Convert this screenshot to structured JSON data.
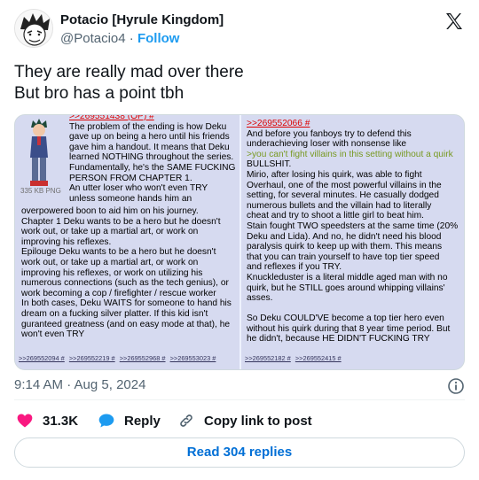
{
  "author": {
    "name": "Potacio [Hyrule Kingdom]",
    "handle": "@Potacio4",
    "dot": "·",
    "follow_label": "Follow"
  },
  "tweet": {
    "lines": [
      "They are really mad over there",
      "But bro has a point tbh"
    ]
  },
  "media": {
    "left_post": {
      "number": ">>269551438 (OP) #",
      "file_size": "335 KB PNG",
      "lines": [
        "The problem of the ending is how Deku",
        "gave up on being a hero until his friends",
        "gave him a handout. It means that Deku",
        "learned NOTHING throughout the series.",
        "Fundamentally, he's the SAME FUCKING",
        "PERSON FROM CHAPTER 1.",
        "An utter loser who won't even TRY",
        "unless someone hands him an",
        "overpowered boon to aid him on his journey.",
        "Chapter 1 Deku wants to be a hero but he doesn't",
        "work out, or take up a martial art, or work on",
        "improving his reflexes.",
        "Epilouge Deku wants to be a hero but he doesn't",
        "work out, or take up a martial art, or work on",
        "improving his reflexes, or work on utilizing his",
        "numerous connections (such as the tech genius), or",
        "work becoming a cop / firefighter / rescue worker",
        "In both cases, Deku WAITS for someone to hand his",
        "dream on a fucking silver platter. If this kid isn't",
        "guranteed greatness (and on easy mode at that), he",
        "won't even TRY"
      ],
      "backlinks": [
        ">>269552094 #",
        ">>269552219 #",
        ">>269552968 #",
        ">>269553023 #"
      ]
    },
    "right_post": {
      "number": ">>269552066 #",
      "lines": [
        "And before you fanboys try to defend this",
        "underachieving loser with nonsense like",
        ">you can't fight villains in this setting without a quirk",
        "BULLSHIT.",
        "Mirio, after losing his quirk, was able to fight",
        "Overhaul, one of the most powerful villains in the",
        "setting, for several minutes. He casually dodged",
        "numerous bullets and the villain had to literally",
        "cheat and try to shoot a little girl to beat him.",
        "Stain fought TWO speedsters at the same time (20%",
        "Deku and Lida). And no, he didn't need his blood",
        "paralysis quirk to keep up with them. This means",
        "that you can train yourself to have top tier speed",
        "and reflexes if you TRY.",
        "Knuckleduster is a literal middle aged man with no",
        "quirk, but he STILL goes around whipping villains'",
        "asses.",
        "",
        "So Deku COULD'VE become a top tier hero even",
        "without his quirk during that 8 year time period. But",
        "he didn't, because HE DIDN'T FUCKING TRY"
      ],
      "backlinks": [
        ">>269552182 #",
        ">>269552415 #"
      ]
    }
  },
  "meta": {
    "timestamp": "9:14 AM · Aug 5, 2024"
  },
  "actions": {
    "like_count": "31.3K",
    "reply_label": "Reply",
    "copy_label": "Copy link to post"
  },
  "read_replies_label": "Read 304 replies",
  "colors": {
    "accent": "#1d9bf0",
    "like": "#f91880",
    "text": "#0f1419",
    "muted": "#536471",
    "board_bg": "#d6daf0",
    "post_link": "#dd0000",
    "greentext": "#789922"
  }
}
